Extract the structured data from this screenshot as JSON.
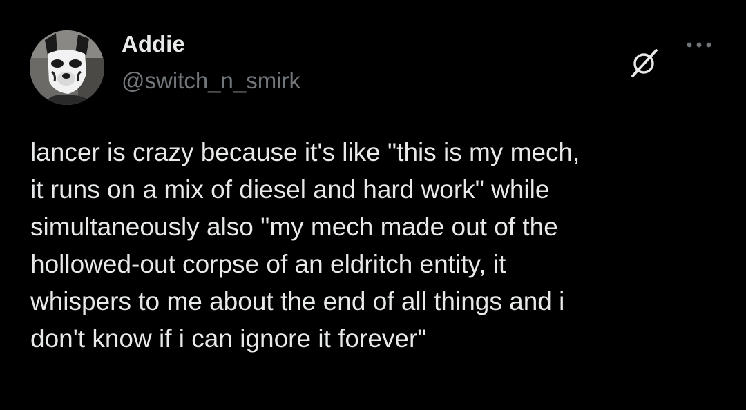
{
  "post": {
    "author": {
      "display_name": "Addie",
      "handle": "@switch_n_smirk",
      "avatar_icon": "avatar-pup-mask"
    },
    "actions": {
      "grok_icon": "grok-icon",
      "more_icon": "more-horizontal-icon"
    },
    "text": "lancer is crazy because it's like \"this is my mech,\nit runs on a mix of diesel and hard work\"  while\nsimultaneously also \"my mech made out of the\nhollowed-out corpse of an eldritch entity, it\nwhispers to me about the end of all things and i\ndon't know if i can ignore it forever\""
  },
  "colors": {
    "background": "#000000",
    "primary_text": "#e7e9ea",
    "secondary_text": "#71767b"
  }
}
